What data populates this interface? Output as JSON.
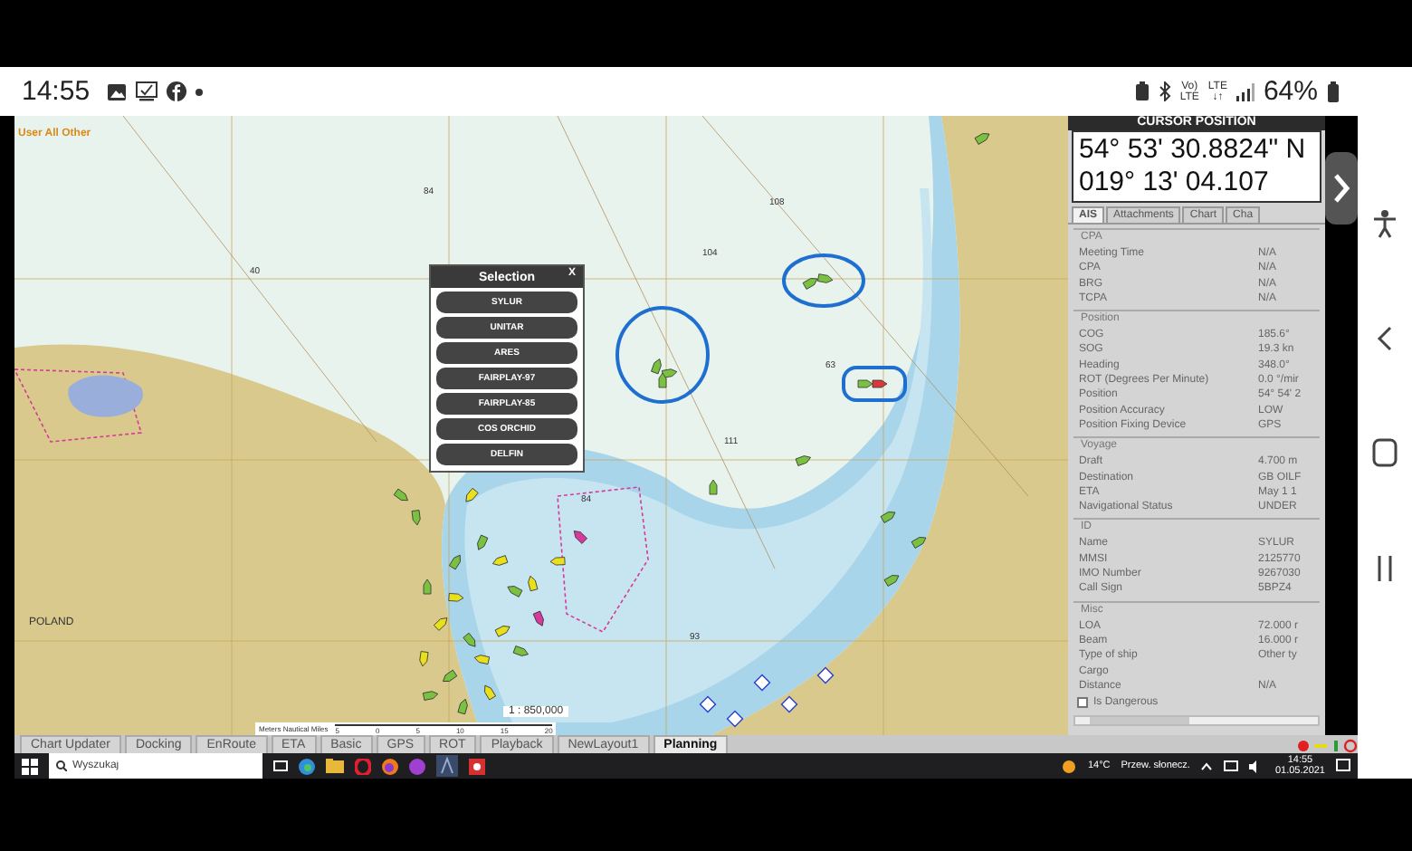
{
  "phone_status": {
    "time": "14:55",
    "network": [
      {
        "top": "Vo)",
        "bottom": "LTE"
      },
      {
        "top": "LTE",
        "bottom": "↓↑"
      }
    ],
    "battery": "64%"
  },
  "chart": {
    "labels": [
      {
        "kind": "layer",
        "text": "User All Other"
      },
      {
        "kind": "depth",
        "text": "84"
      },
      {
        "kind": "depth",
        "text": "40"
      },
      {
        "kind": "depth",
        "text": "104"
      },
      {
        "kind": "depth",
        "text": "108"
      },
      {
        "kind": "depth",
        "text": "111"
      },
      {
        "kind": "depth",
        "text": "63"
      },
      {
        "kind": "depth",
        "text": "84"
      },
      {
        "kind": "depth",
        "text": "93"
      },
      {
        "kind": "region",
        "text": "POLAND"
      }
    ],
    "scale": "1 : 850,000",
    "scale_bar": {
      "unit": "Meters Nautical Miles",
      "ticks": [
        "5",
        "0",
        "5",
        "10",
        "15",
        "20"
      ]
    }
  },
  "selection": {
    "title": "Selection",
    "close": "X",
    "items": [
      "SYLUR",
      "UNITAR",
      "ARES",
      "FAIRPLAY-97",
      "FAIRPLAY-85",
      "COS ORCHID",
      "DELFIN"
    ]
  },
  "panel": {
    "header": "CURSOR POSITION",
    "lat": "54° 53' 30.8824\" N",
    "lon": "019° 13' 04.107",
    "tabs": [
      {
        "label": "AIS",
        "selected": true
      },
      {
        "label": "Attachments",
        "selected": false
      },
      {
        "label": "Chart",
        "selected": false
      },
      {
        "label": "Cha",
        "selected": false
      }
    ],
    "sections": [
      {
        "title": "CPA",
        "rows": [
          {
            "label": "Meeting Time",
            "value": "N/A"
          },
          {
            "label": "CPA",
            "value": "N/A"
          },
          {
            "label": "BRG",
            "value": "N/A"
          },
          {
            "label": "TCPA",
            "value": "N/A"
          }
        ]
      },
      {
        "title": "Position",
        "rows": [
          {
            "label": "COG",
            "value": "185.6°"
          },
          {
            "label": "SOG",
            "value": "19.3 kn"
          },
          {
            "label": "Heading",
            "value": "348.0°"
          },
          {
            "label": "ROT (Degrees Per Minute)",
            "value": "0.0 °/mir"
          },
          {
            "label": "Position",
            "value": "54° 54' 2"
          },
          {
            "label": "Position Accuracy",
            "value": "LOW"
          },
          {
            "label": "Position Fixing Device",
            "value": "GPS"
          }
        ]
      },
      {
        "title": "Voyage",
        "rows": [
          {
            "label": "Draft",
            "value": "4.700 m"
          },
          {
            "label": "Destination",
            "value": "GB OILF"
          },
          {
            "label": "ETA",
            "value": "May 1 1"
          },
          {
            "label": "Navigational Status",
            "value": "UNDER"
          }
        ]
      },
      {
        "title": "ID",
        "rows": [
          {
            "label": "Name",
            "value": "SYLUR"
          },
          {
            "label": "MMSI",
            "value": "2125770"
          },
          {
            "label": "IMO Number",
            "value": "9267030"
          },
          {
            "label": "Call Sign",
            "value": "5BPZ4"
          }
        ]
      },
      {
        "title": "Misc",
        "rows": [
          {
            "label": "LOA",
            "value": "72.000 r"
          },
          {
            "label": "Beam",
            "value": "16.000 r"
          },
          {
            "label": "Type of ship",
            "value": "Other ty"
          },
          {
            "label": "Cargo",
            "value": ""
          },
          {
            "label": "Distance",
            "value": "N/A"
          }
        ]
      }
    ],
    "dangerous": {
      "label": "Is Dangerous",
      "checked": false
    }
  },
  "bottom_tabs": [
    {
      "label": "Chart Updater",
      "selected": false
    },
    {
      "label": "Docking",
      "selected": false
    },
    {
      "label": "EnRoute",
      "selected": false
    },
    {
      "label": "ETA",
      "selected": false
    },
    {
      "label": "Basic",
      "selected": false
    },
    {
      "label": "GPS",
      "selected": false
    },
    {
      "label": "ROT",
      "selected": false
    },
    {
      "label": "Playback",
      "selected": false
    },
    {
      "label": "NewLayout1",
      "selected": false
    },
    {
      "label": "Planning",
      "selected": true
    }
  ],
  "taskbar": {
    "search_placeholder": "Wyszukaj",
    "temperature": "14°C",
    "weather": "Przew. słonecz.",
    "time": "14:55",
    "date": "01.05.2021"
  }
}
